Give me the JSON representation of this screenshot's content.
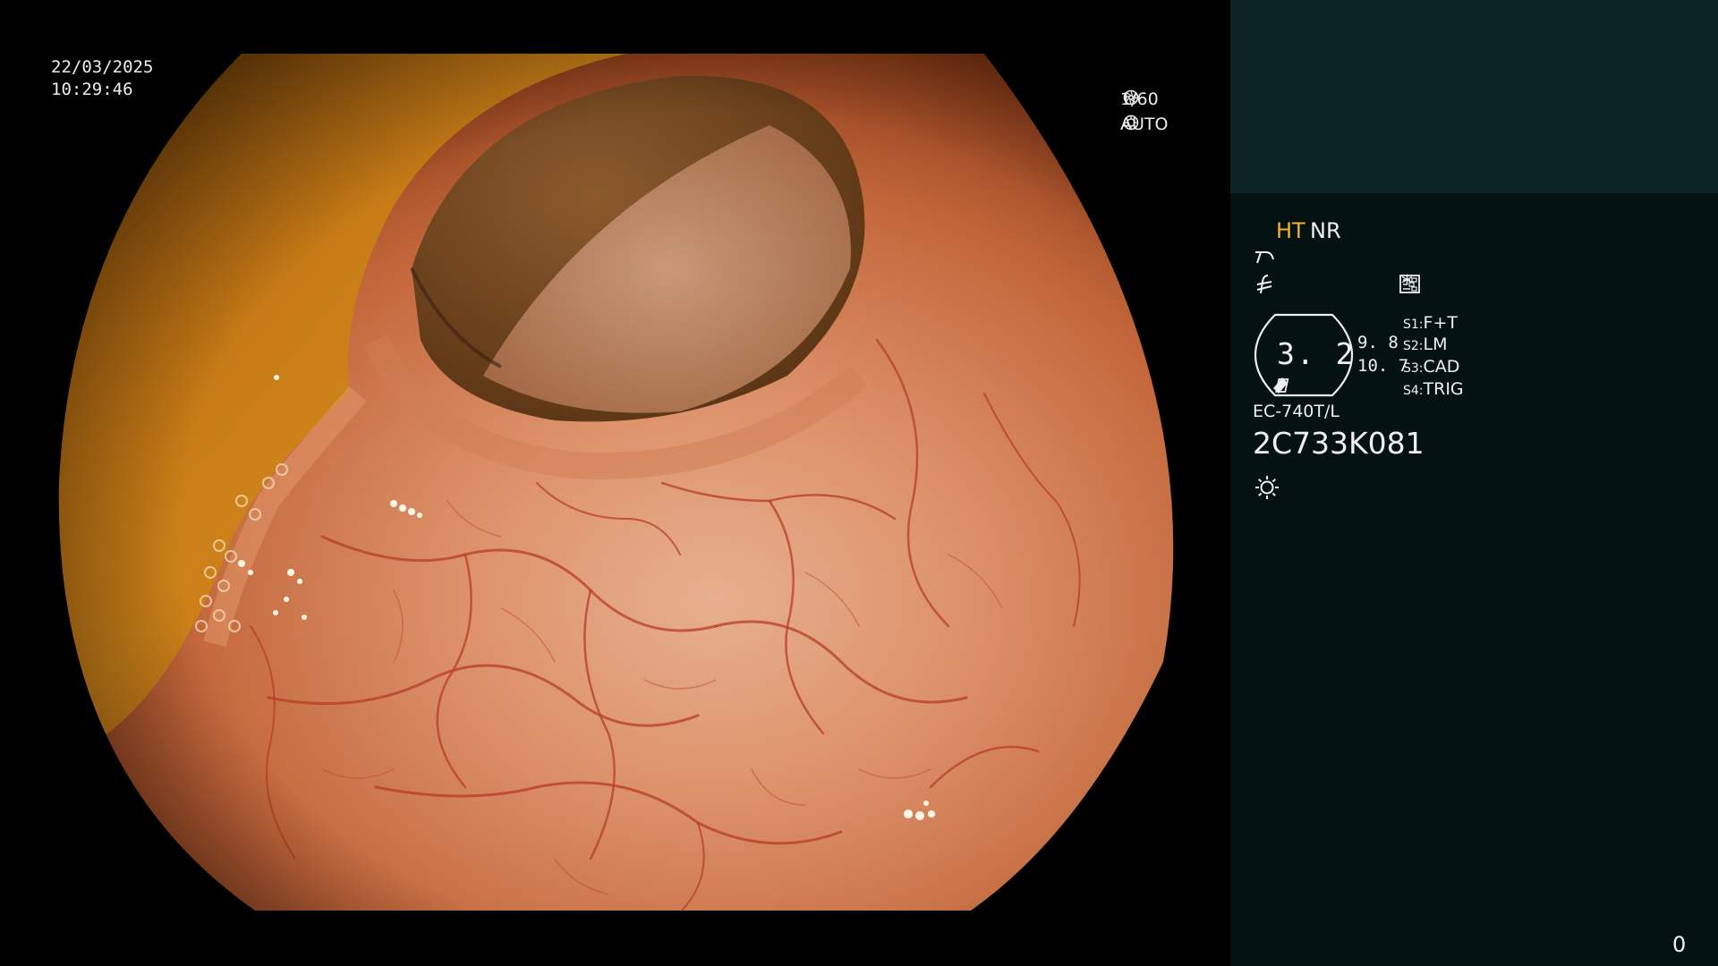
{
  "overlay": {
    "date": "22/03/2025",
    "time": "10:29:46",
    "shutter": "1/60",
    "shutter_icon": "aperture-icon",
    "iris": "AUTO",
    "iris_icon": "iris-icon"
  },
  "panel": {
    "mode_ht": "HT",
    "mode_nr": "NR",
    "icons": [
      "curve-icon",
      "f-negated-icon",
      "settings-list-icon",
      "light-icon"
    ],
    "asterisk": "*",
    "hex_value": "3. 2",
    "value_a": "9. 8",
    "value_b": "10. 7",
    "switches": [
      {
        "key": "S1:",
        "value": "F+T"
      },
      {
        "key": "S2:",
        "value": "LM"
      },
      {
        "key": "S3:",
        "value": "CAD"
      },
      {
        "key": "S4:",
        "value": "TRIG"
      }
    ],
    "scope_model": "EC-740T/L",
    "scope_serial": "2C733K081",
    "counter": "0"
  },
  "colors": {
    "panel_bg": "#041211",
    "panel_top_bg": "#0d2425",
    "ht_accent": "#f2b233",
    "tissue_mid": "#d98a5c",
    "tissue_dark": "#7a3416",
    "vessel": "#b8402a",
    "fold_yellow": "#c47a10"
  }
}
